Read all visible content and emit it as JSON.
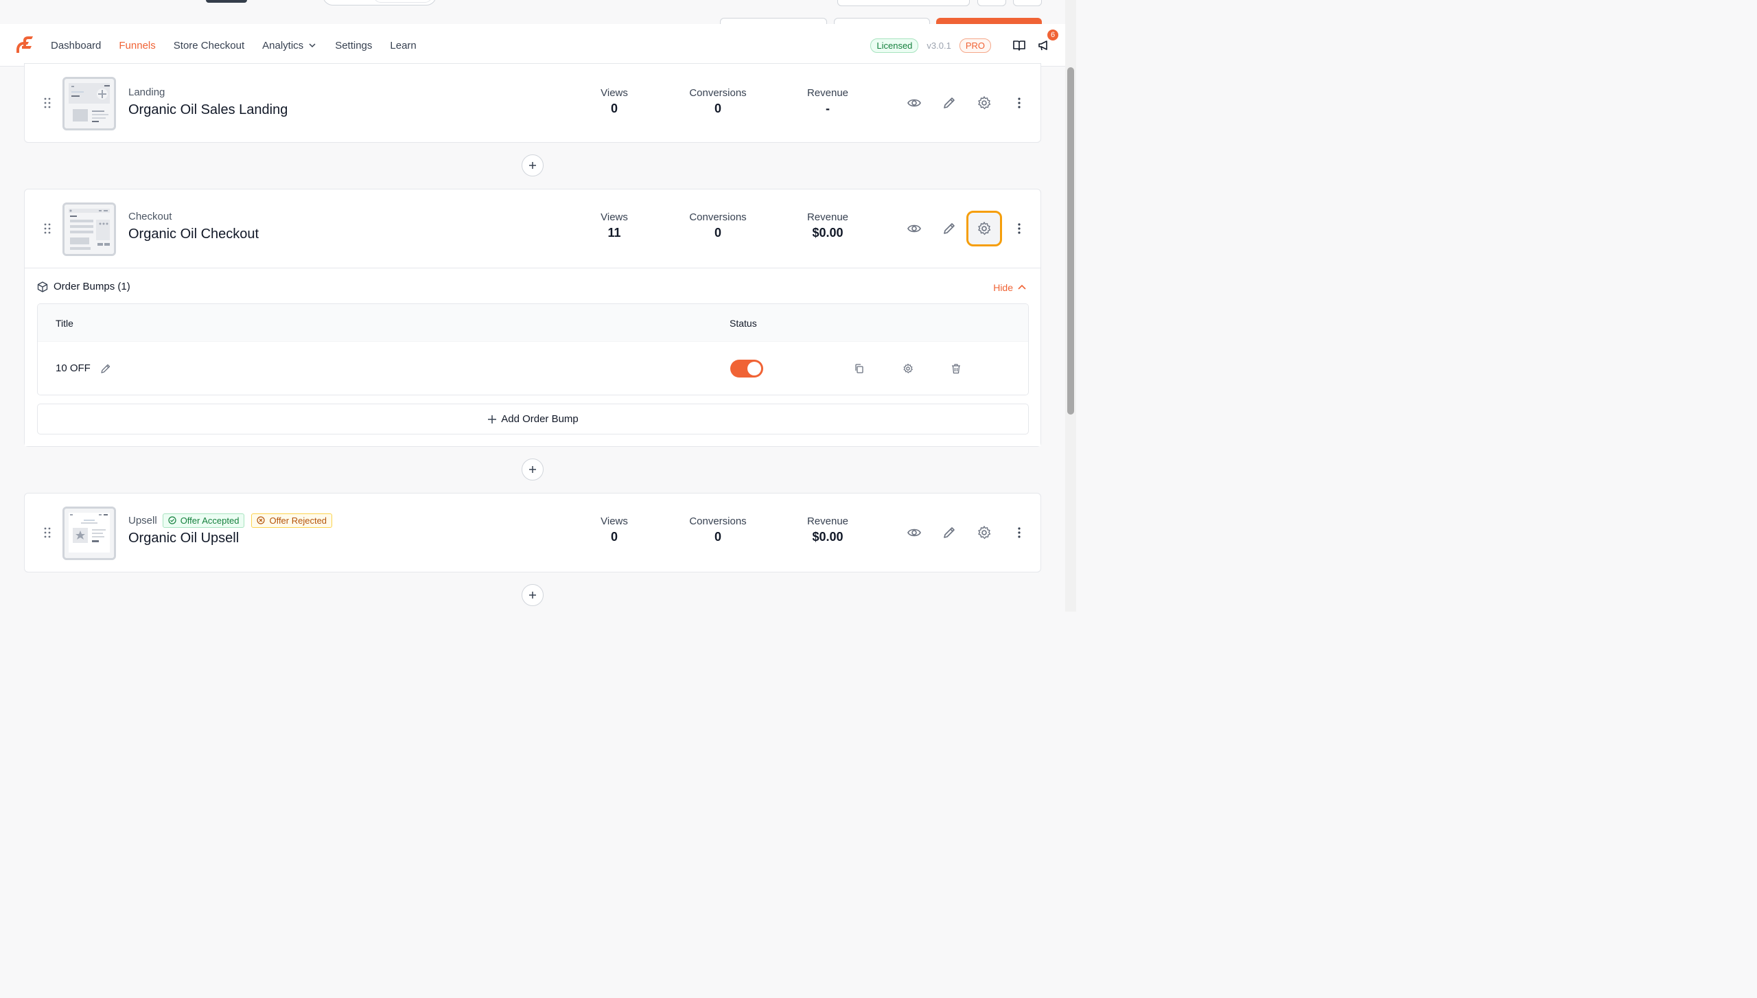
{
  "nav": {
    "items": [
      {
        "label": "Dashboard"
      },
      {
        "label": "Funnels"
      },
      {
        "label": "Store Checkout"
      },
      {
        "label": "Analytics"
      },
      {
        "label": "Settings"
      },
      {
        "label": "Learn"
      }
    ],
    "active": "Funnels",
    "license_badge": "Licensed",
    "version": "v3.0.1",
    "pro_badge": "PRO",
    "notification_count": "6"
  },
  "colors": {
    "accent": "#f06335",
    "highlight": "#f59e0b",
    "success": "#15803d",
    "warning": "#b45309"
  },
  "steps": [
    {
      "type": "Landing",
      "name": "Organic Oil Sales Landing",
      "metrics": {
        "views_label": "Views",
        "views": "0",
        "conversions_label": "Conversions",
        "conversions": "0",
        "revenue_label": "Revenue",
        "revenue": "-"
      }
    },
    {
      "type": "Checkout",
      "name": "Organic Oil Checkout",
      "metrics": {
        "views_label": "Views",
        "views": "11",
        "conversions_label": "Conversions",
        "conversions": "0",
        "revenue_label": "Revenue",
        "revenue": "$0.00"
      },
      "order_bumps": {
        "heading": "Order Bumps (1)",
        "hide_label": "Hide",
        "columns": {
          "title": "Title",
          "status": "Status"
        },
        "rows": [
          {
            "title": "10 OFF",
            "enabled": true
          }
        ],
        "add_label": "Add Order Bump"
      }
    },
    {
      "type": "Upsell",
      "name": "Organic Oil Upsell",
      "badges": {
        "accepted": "Offer Accepted",
        "rejected": "Offer Rejected"
      },
      "metrics": {
        "views_label": "Views",
        "views": "0",
        "conversions_label": "Conversions",
        "conversions": "0",
        "revenue_label": "Revenue",
        "revenue": "$0.00"
      }
    }
  ]
}
